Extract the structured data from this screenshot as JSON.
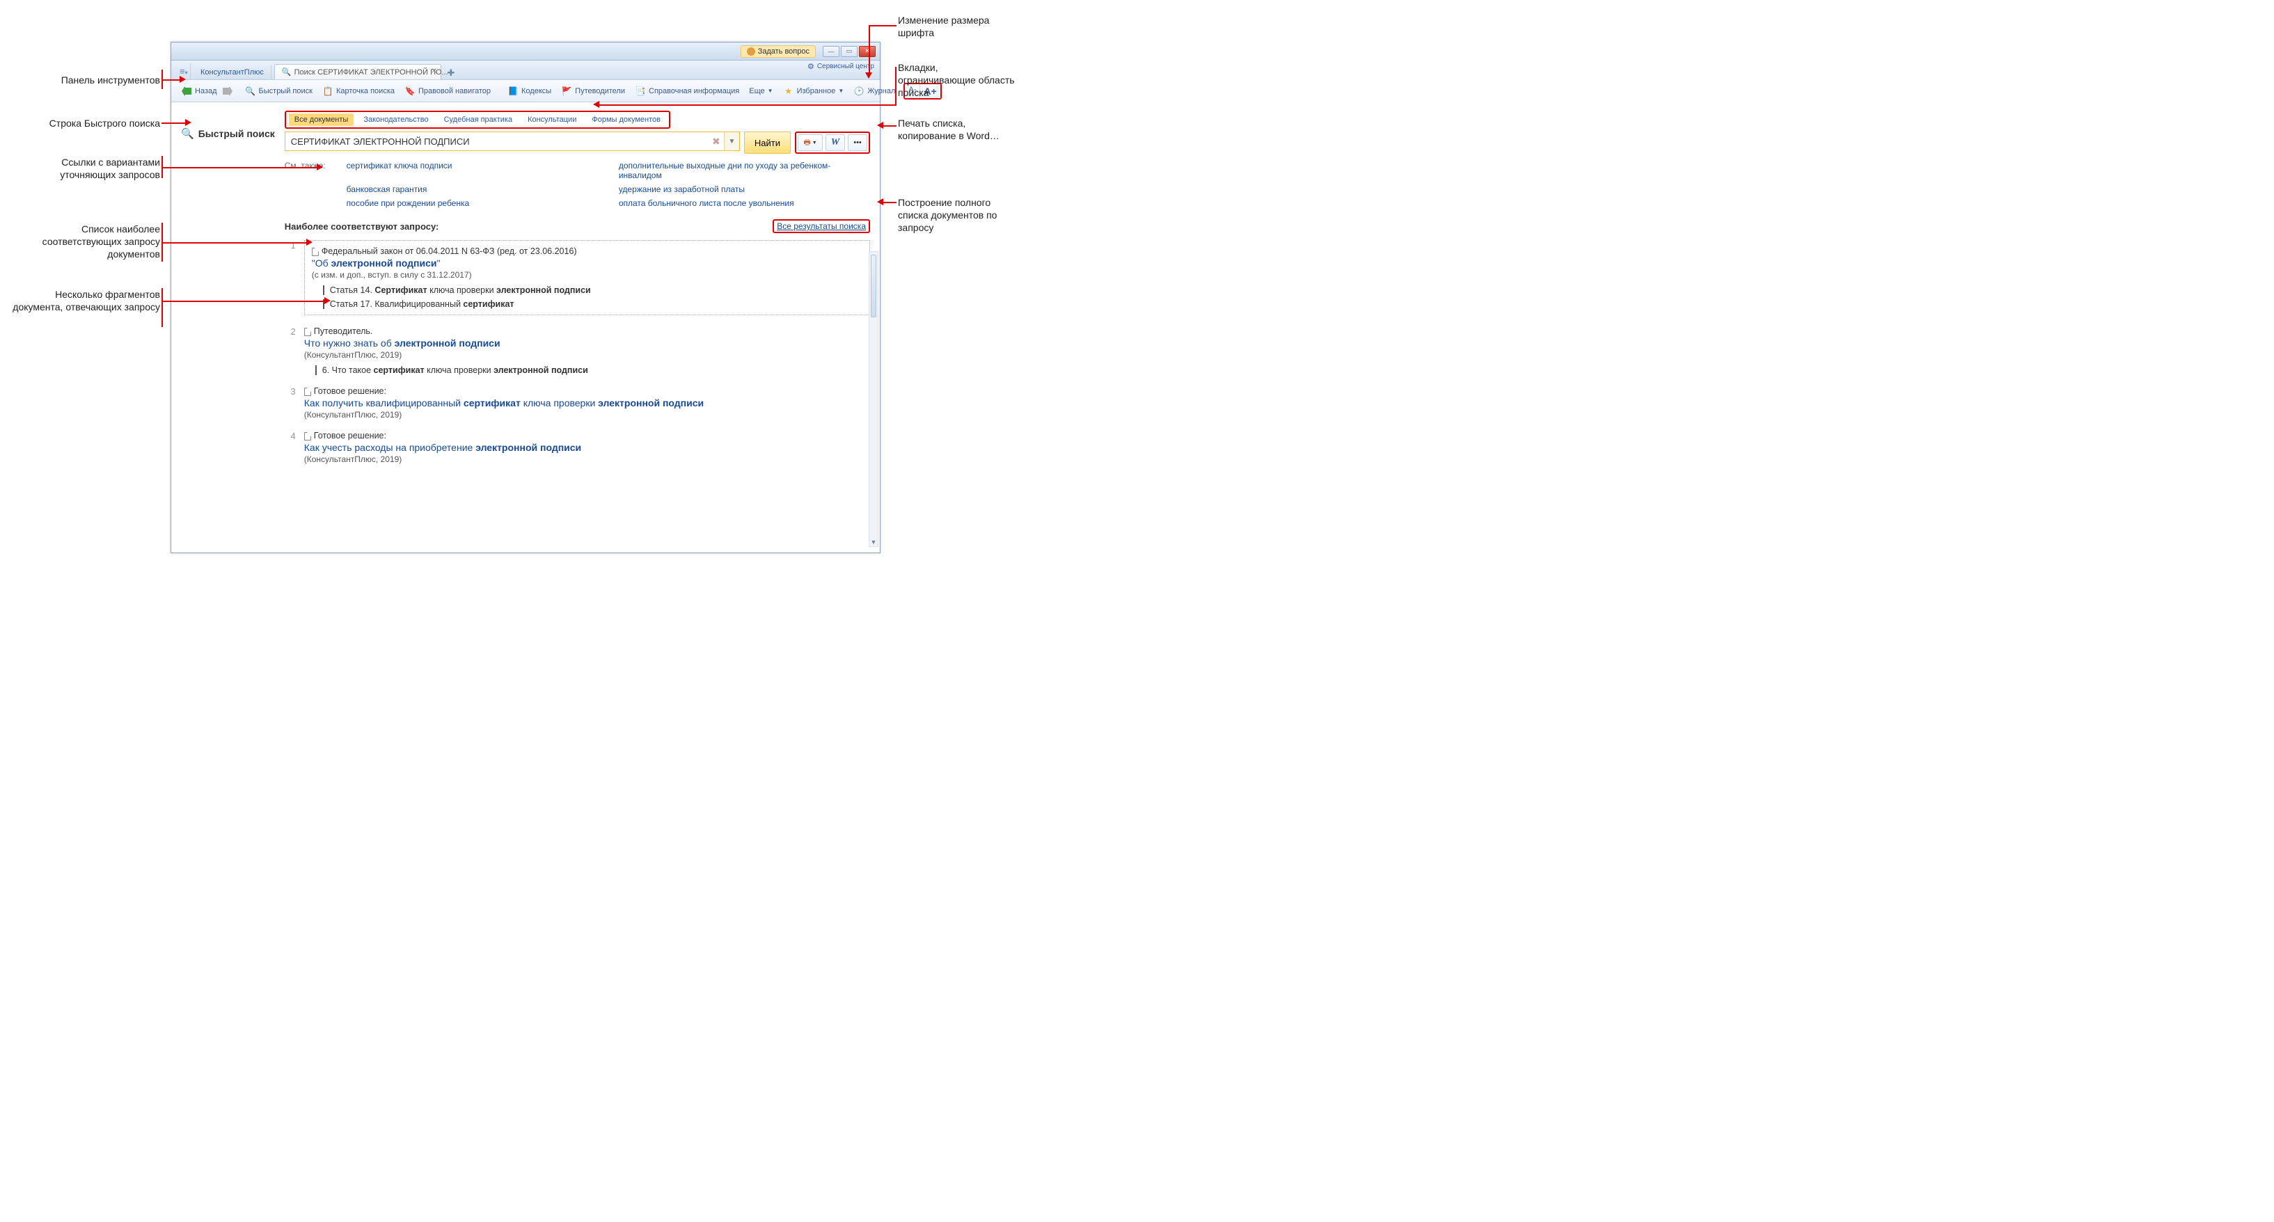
{
  "titlebar": {
    "ask_question": "Задать вопрос",
    "service_center": "Сервисный центр"
  },
  "tabs": {
    "pinned": "КонсультантПлюс",
    "active": "Поиск СЕРТИФИКАТ ЭЛЕКТРОННОЙ ПО..."
  },
  "toolbar": {
    "back": "Назад",
    "quick_search": "Быстрый поиск",
    "card_search": "Карточка поиска",
    "legal_nav": "Правовой навигатор",
    "codes": "Кодексы",
    "guides": "Путеводители",
    "reference": "Справочная информация",
    "more": "Еще",
    "favorites": "Избранное",
    "journal": "Журнал",
    "font_minus": "A-",
    "font_plus": "A+"
  },
  "search": {
    "title": "Быстрый поиск",
    "query": "СЕРТИФИКАТ ЭЛЕКТРОННОЙ ПОДПИСИ",
    "placeholder": "",
    "find": "Найти"
  },
  "scopes": {
    "all": "Все документы",
    "law": "Законодательство",
    "court": "Судебная практика",
    "consult": "Консультации",
    "forms": "Формы документов"
  },
  "see_also": {
    "label": "См. также:",
    "left": [
      "сертификат ключа подписи",
      "банковская гарантия",
      "пособие при рождении ребенка"
    ],
    "right": [
      "дополнительные выходные дни по уходу за ребенком-инвалидом",
      "удержание из заработной платы",
      "оплата больничного листа после увольнения"
    ]
  },
  "results": {
    "header": "Наиболее соответствуют запросу:",
    "all_link": "Все результаты поиска",
    "items": [
      {
        "num": "1",
        "meta": "Федеральный закон от 06.04.2011 N 63-ФЗ (ред. от 23.06.2016)",
        "title_html": "\"Об <b>электронной подписи</b>\"",
        "sub": "(с изм. и доп., вступ. в силу с 31.12.2017)",
        "frags": [
          "Статья 14. <b>Сертификат</b> ключа проверки <b>электронной подписи</b>",
          "Статья 17. Квалифицированный <b>сертификат</b>"
        ]
      },
      {
        "num": "2",
        "meta": "Путеводитель.",
        "title_html": "Что нужно знать об <b>электронной подписи</b>",
        "sub": "(КонсультантПлюс, 2019)",
        "frags": [
          "6. Что такое <b>сертификат</b> ключа проверки <b>электронной подписи</b>"
        ]
      },
      {
        "num": "3",
        "meta": "Готовое решение:",
        "title_html": "Как получить квалифицированный <b>сертификат</b> ключа проверки <b>электронной подписи</b>",
        "sub": "(КонсультантПлюс, 2019)",
        "frags": []
      },
      {
        "num": "4",
        "meta": "Готовое решение:",
        "title_html": "Как учесть расходы на приобретение <b>электронной подписи</b>",
        "sub": "(КонсультантПлюс, 2019)",
        "frags": []
      }
    ]
  },
  "right_tools": {
    "word": "W",
    "more": "•••"
  },
  "annotations": {
    "toolbar_panel": "Панель инструментов",
    "search_row": "Строка Быстрого поиска",
    "refine_links": "Ссылки с вариантами уточняющих запросов",
    "best_match": "Список наиболее соответствующих запросу документов",
    "fragments": "Несколько фрагментов документа, отвечающих запросу",
    "font_change": "Изменение размера шрифта",
    "scope_tabs": "Вкладки, ограничивающие область поиска",
    "print_copy": "Печать списка, копирование в Word…",
    "full_list": "Построение полного списка документов по запросу"
  }
}
